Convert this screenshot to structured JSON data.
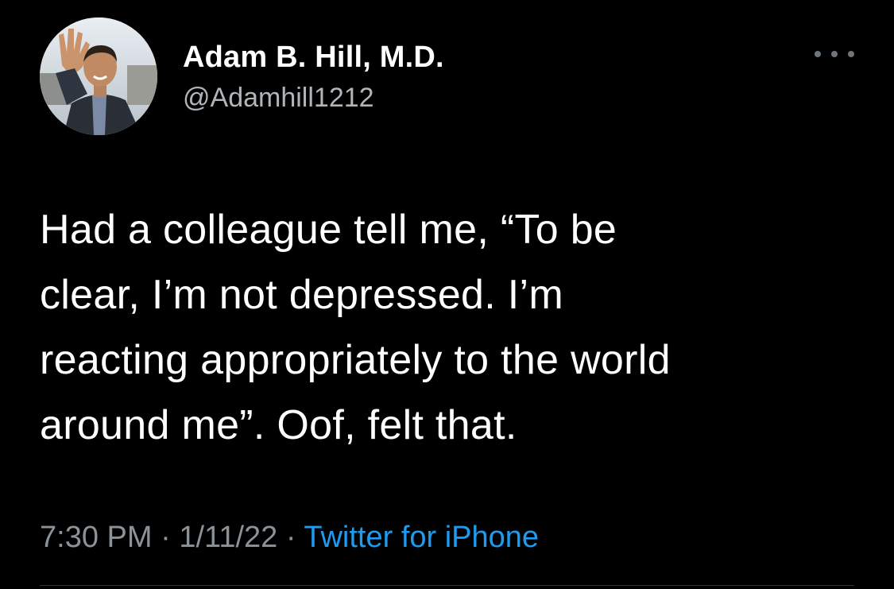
{
  "author": {
    "display_name": "Adam B. Hill, M.D.",
    "handle": "@Adamhill1212"
  },
  "tweet": {
    "text": "Had a colleague tell me, “To be\nclear, I’m not depressed. I’m\nreacting appropriately to the world\naround me”. Oof, felt that.",
    "time": "7:30 PM",
    "date": "1/11/22",
    "separator": " · ",
    "source": "Twitter for iPhone"
  },
  "icons": {
    "more": "more-horizontal-icon",
    "avatar": "profile-photo"
  },
  "colors": {
    "background": "#000000",
    "text": "#ffffff",
    "secondary_text": "#8b9298",
    "link": "#1d9bf0"
  }
}
